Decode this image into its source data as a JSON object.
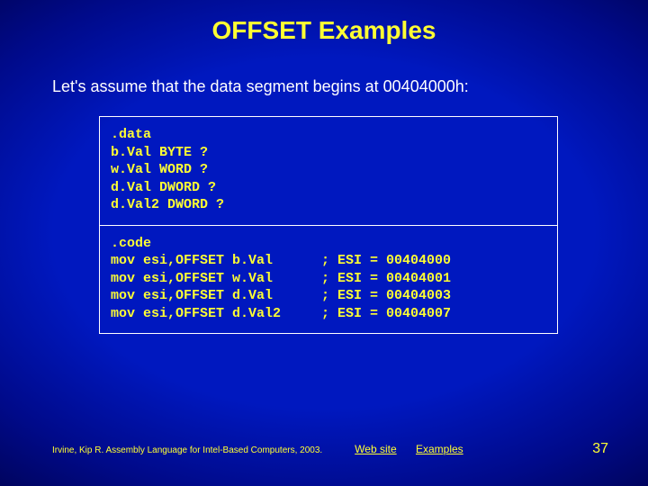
{
  "title": "OFFSET Examples",
  "intro": "Let's assume that the data segment begins at 00404000h:",
  "code_data": ".data\nb.Val BYTE ?\nw.Val WORD ?\nd.Val DWORD ?\nd.Val2 DWORD ?",
  "code_code": ".code\nmov esi,OFFSET b.Val      ; ESI = 00404000\nmov esi,OFFSET w.Val      ; ESI = 00404001\nmov esi,OFFSET d.Val      ; ESI = 00404003\nmov esi,OFFSET d.Val2     ; ESI = 00404007",
  "citation": "Irvine, Kip R. Assembly Language for Intel-Based Computers, 2003.",
  "link_web": "Web site",
  "link_examples": "Examples",
  "page": "37"
}
